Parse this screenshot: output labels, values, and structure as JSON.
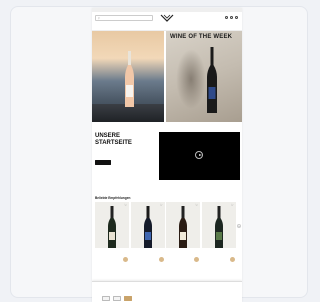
{
  "announcement": "",
  "search": {
    "placeholder": ""
  },
  "nav": {
    "items": [
      "",
      "",
      "",
      "",
      "",
      "",
      "",
      "",
      ""
    ]
  },
  "hero": {
    "left_text": "",
    "right_title": "WINE OF THE WEEK"
  },
  "story": {
    "title_line1": "UNSERE",
    "title_line2": "STARTSEITE",
    "text": "",
    "button": ""
  },
  "products": {
    "title": "Beliebte Empfehlungen",
    "items": [
      {
        "name": "",
        "price": ""
      },
      {
        "name": "",
        "price": ""
      },
      {
        "name": "",
        "price": ""
      },
      {
        "name": "",
        "price": ""
      }
    ]
  },
  "cookie": {
    "title": "",
    "text": "",
    "buttons": [
      "",
      "",
      ""
    ]
  },
  "colors": {
    "page_bg": "#f0f2f6",
    "accent": "#c9a36a",
    "dark": "#111111"
  }
}
